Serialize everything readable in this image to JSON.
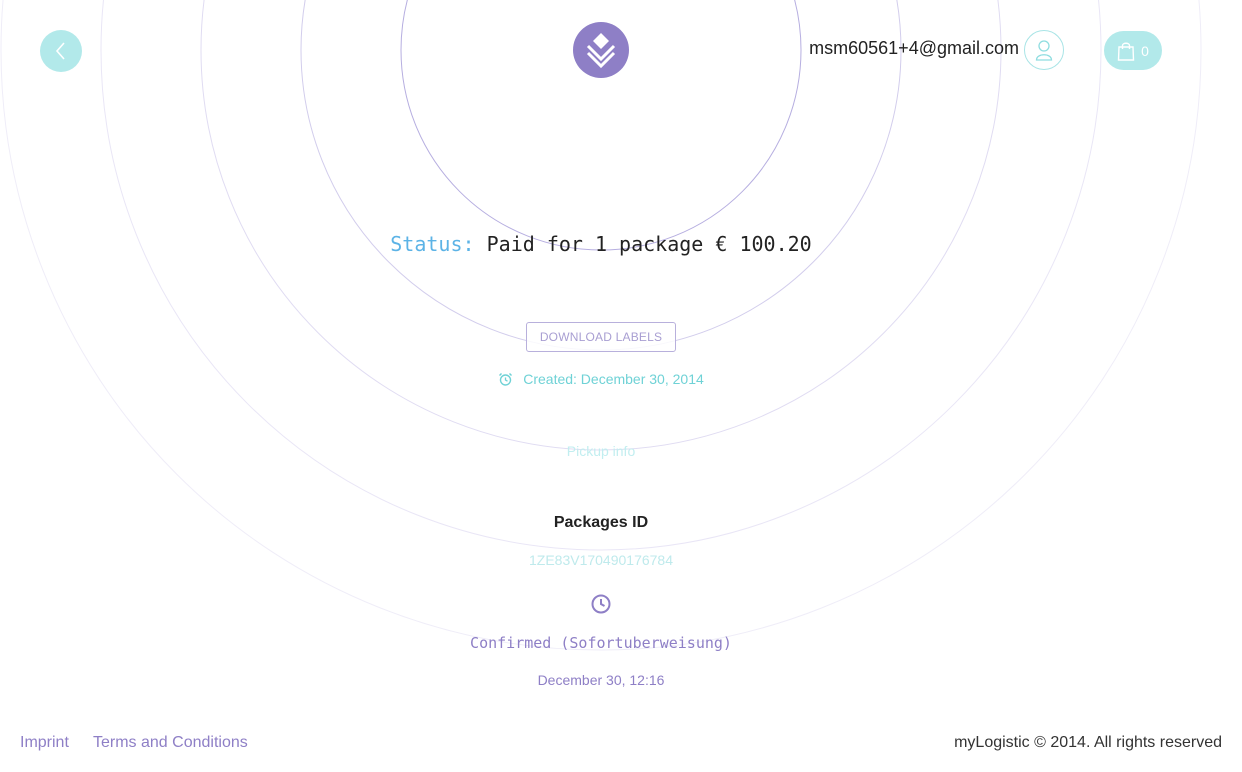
{
  "header": {
    "back_icon": "chevron-left-icon",
    "logo_icon": "stacked-box-logo-icon",
    "user_email": "msm60561+4@gmail.com",
    "user_icon": "user-icon",
    "cart_icon": "shopping-bag-icon",
    "cart_count": "0"
  },
  "status": {
    "label": "Status:",
    "value": "Paid for 1 package € 100.20"
  },
  "actions": {
    "download_labels": "DOWNLOAD LABELS"
  },
  "created": {
    "icon": "alarm-clock-icon",
    "text": "Created: December 30, 2014"
  },
  "pickup": {
    "link_label": "Pickup info"
  },
  "packages": {
    "heading": "Packages ID",
    "id": "1ZE83V170490176784"
  },
  "confirmation": {
    "icon": "clock-icon",
    "text": "Confirmed (Sofortuberweisung)",
    "date": "December 30, 12:16"
  },
  "footer": {
    "imprint": "Imprint",
    "terms": "Terms and Conditions",
    "copyright": "myLogistic © 2014. All rights reserved"
  },
  "colors": {
    "accent_teal": "#b2e9ea",
    "accent_purple": "#8e7fc6",
    "status_blue": "#5cb3e6"
  }
}
